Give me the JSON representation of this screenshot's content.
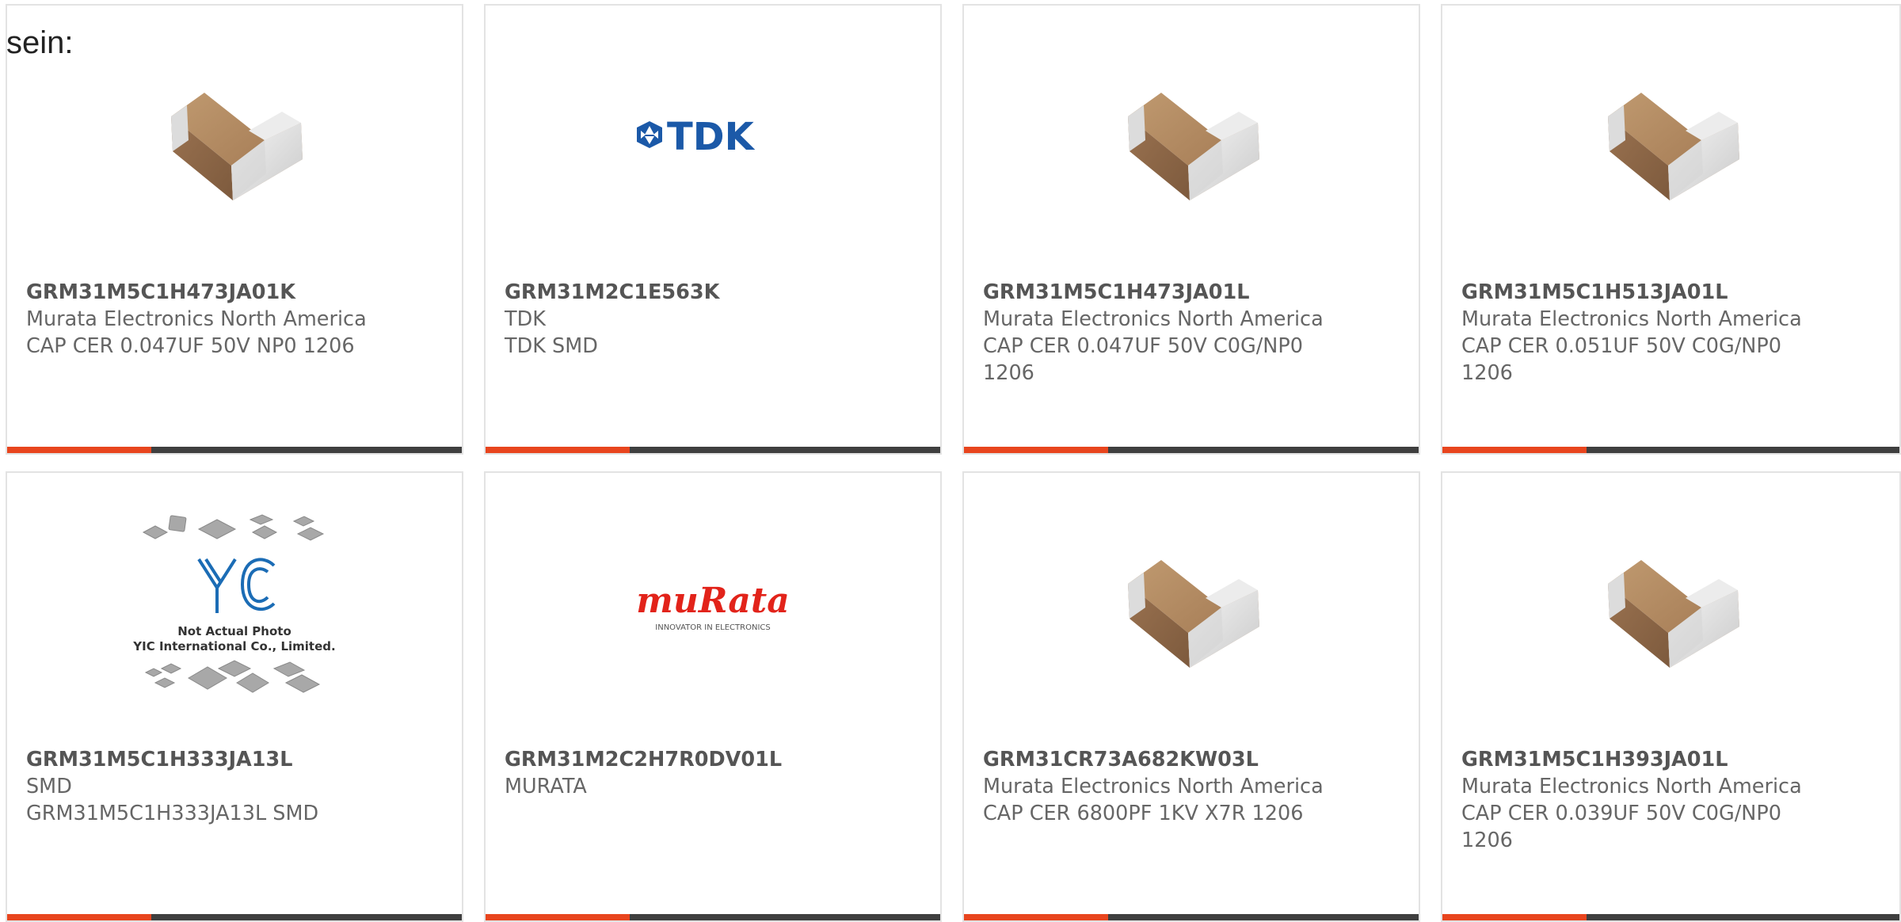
{
  "intro_text": "sein:",
  "colors": {
    "accent": "#e8451e",
    "bar": "#3f3f3f",
    "card_border": "#e3e3e3",
    "text": "#666666",
    "tdk_blue": "#1b59a8",
    "murata_red": "#e2231a"
  },
  "cards": [
    {
      "part_number": "GRM31M5C1H473JA01K",
      "manufacturer": "Murata Electronics North America",
      "description": "CAP CER 0.047UF 50V NP0 1206",
      "image": "capacitor-chip"
    },
    {
      "part_number": "GRM31M2C1E563K",
      "manufacturer": "TDK",
      "description": "TDK SMD",
      "image": "tdk-logo",
      "logo_text": "TDK"
    },
    {
      "part_number": "GRM31M5C1H473JA01L",
      "manufacturer": "Murata Electronics North America",
      "description": "CAP CER 0.047UF 50V C0G/NP0 1206",
      "image": "capacitor-chip"
    },
    {
      "part_number": "GRM31M5C1H513JA01L",
      "manufacturer": "Murata Electronics North America",
      "description": "CAP CER 0.051UF 50V C0G/NP0 1206",
      "image": "capacitor-chip"
    },
    {
      "part_number": "GRM31M5C1H333JA13L",
      "manufacturer": "SMD",
      "description": "GRM31M5C1H333JA13L SMD",
      "image": "yic-placeholder",
      "image_text_1": "Not Actual Photo",
      "image_text_2": "YIC International Co., Limited."
    },
    {
      "part_number": "GRM31M2C2H7R0DV01L",
      "manufacturer": "MURATA",
      "description": "",
      "image": "murata-logo",
      "logo_text": "muRata",
      "logo_tagline": "INNOVATOR IN ELECTRONICS"
    },
    {
      "part_number": "GRM31CR73A682KW03L",
      "manufacturer": "Murata Electronics North America",
      "description": "CAP CER 6800PF 1KV X7R 1206",
      "image": "capacitor-chip"
    },
    {
      "part_number": "GRM31M5C1H393JA01L",
      "manufacturer": "Murata Electronics North America",
      "description": "CAP CER 0.039UF 50V C0G/NP0 1206",
      "image": "capacitor-chip"
    }
  ]
}
